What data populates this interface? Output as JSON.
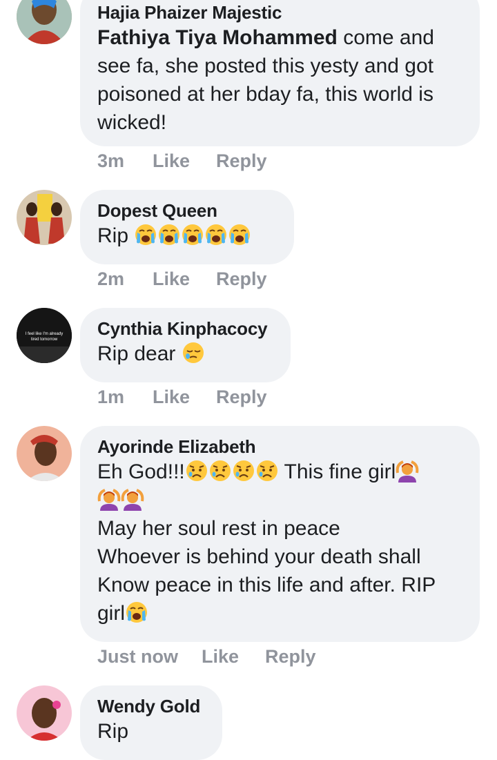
{
  "comments": [
    {
      "author": "Hajia Phaizer Majestic",
      "mention": "Fathiya Tiya Mohammed",
      "text_after_mention": " come and see fa, she posted this yesty and got poisoned at her bday fa, this world is wicked!",
      "time": "3m",
      "like": "Like",
      "reply": "Reply"
    },
    {
      "author": "Dopest Queen",
      "text": "Rip",
      "emojis": [
        "loudly-crying-face",
        "loudly-crying-face",
        "loudly-crying-face",
        "loudly-crying-face",
        "loudly-crying-face"
      ],
      "time": "2m",
      "like": "Like",
      "reply": "Reply"
    },
    {
      "author": "Cynthia Kinphacocy",
      "text": "Rip dear",
      "emojis": [
        "sleepy-face"
      ],
      "avatar_text": "I feel like I'm already tired tomorrow",
      "time": "1m",
      "like": "Like",
      "reply": "Reply"
    },
    {
      "author": "Ayorinde Elizabeth",
      "line1": "Eh God!!!",
      "line1b": " This fine girl",
      "line3": "May her soul rest in peace",
      "line4": "Whoever is behind your death shall",
      "line5": "Know peace in this life and after. RIP",
      "line6": "girl",
      "emojis": [
        "worried-face",
        "person-gesturing-ok",
        "loudly-crying-face"
      ],
      "time": "Just now",
      "like": "Like",
      "reply": "Reply"
    },
    {
      "author": "Wendy Gold",
      "text": "Rip"
    }
  ],
  "colors": {
    "bubble": "#f0f2f5",
    "text": "#1c1e21",
    "actions": "#90949c"
  }
}
